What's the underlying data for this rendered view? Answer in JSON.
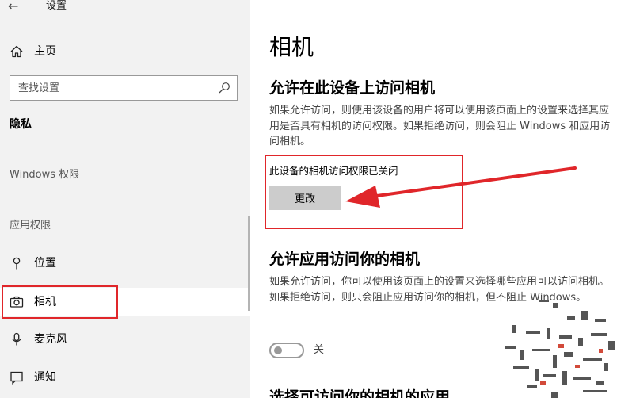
{
  "window": {
    "title": "设置",
    "back_glyph": "←"
  },
  "sidebar": {
    "home_label": "主页",
    "search_placeholder": "查找设置",
    "section_title": "隐私",
    "windows_permissions": "Windows 权限",
    "app_permissions": "应用权限",
    "items": [
      {
        "label": "位置",
        "icon": "location-pin-icon"
      },
      {
        "label": "相机",
        "icon": "camera-icon",
        "active": true
      },
      {
        "label": "麦克风",
        "icon": "microphone-icon"
      },
      {
        "label": "通知",
        "icon": "notification-icon"
      }
    ]
  },
  "main": {
    "title": "相机",
    "device_access": {
      "heading": "允许在此设备上访问相机",
      "description": "如果允许访问，则使用该设备的用户将可以使用该页面上的设置来选择其应用是否具有相机的访问权限。如果拒绝访问，则会阻止 Windows 和应用访问相机。",
      "status": "此设备的相机访问权限已关闭",
      "button": "更改"
    },
    "app_access": {
      "heading": "允许应用访问你的相机",
      "description": "如果允许访问，你可以使用该页面上的设置来选择哪些应用可以访问相机。如果拒绝访问，则只会阻止应用访问你的相机，但不阻止 Windows。",
      "toggle_state": "关",
      "toggle_on": false
    },
    "next_heading": "选择可访问你的相机的应用"
  },
  "colors": {
    "highlight": "#e0262a",
    "sidebar_bg": "#f2f2f2",
    "button_bg": "#cccccc"
  }
}
